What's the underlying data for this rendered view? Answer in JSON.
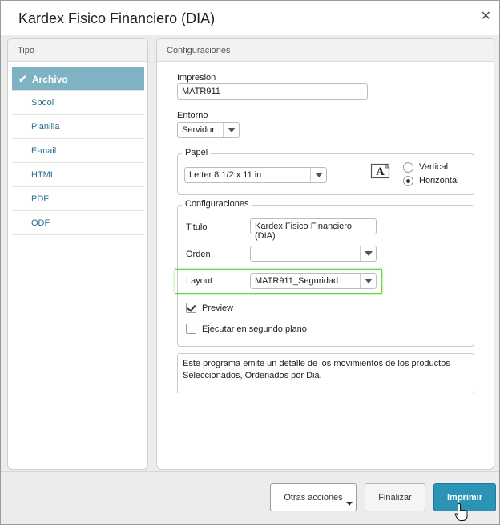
{
  "dialog": {
    "title": "Kardex Fisico Financiero (DIA)",
    "close_icon": "close-icon"
  },
  "tipo": {
    "header": "Tipo",
    "items": [
      {
        "label": "Archivo",
        "active": true
      },
      {
        "label": "Spool"
      },
      {
        "label": "Planilla"
      },
      {
        "label": "E-mail"
      },
      {
        "label": "HTML"
      },
      {
        "label": "PDF"
      },
      {
        "label": "ODF"
      }
    ]
  },
  "config": {
    "header": "Configuraciones",
    "impresion_label": "Impresion",
    "impresion_value": "MATR911",
    "entorno_label": "Entorno",
    "entorno_value": "Servidor",
    "papel": {
      "legend": "Papel",
      "value": "Letter 8 1/2 x 11 in",
      "orientation_icon": "page-orientation-icon",
      "vertical_label": "Vertical",
      "horizontal_label": "Horizontal",
      "selected": "Horizontal"
    },
    "sub": {
      "legend": "Configuraciones",
      "titulo_label": "Titulo",
      "titulo_value": "Kardex Fisico Financiero (DIA)",
      "orden_label": "Orden",
      "orden_value": "",
      "layout_label": "Layout",
      "layout_value": "MATR911_Seguridad",
      "preview_label": "Preview",
      "preview_checked": true,
      "segundo_plano_label": "Ejecutar en segundo plano",
      "segundo_plano_checked": false
    },
    "description": "Este programa emite un detalle de los movimientos de los productos Seleccionados, Ordenados por Dia."
  },
  "footer": {
    "otras_acciones": "Otras acciones",
    "finalizar": "Finalizar",
    "imprimir": "Imprimir"
  },
  "colors": {
    "accent": "#2b93b6",
    "active_item": "#7fb3c3",
    "highlight_border": "#6fd04a"
  }
}
